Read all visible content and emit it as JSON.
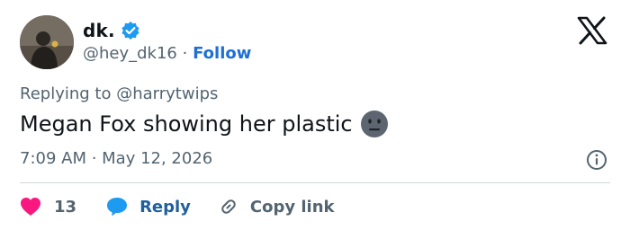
{
  "user": {
    "display_name": "dk.",
    "handle": "@hey_dk16",
    "separator": "·",
    "follow_label": "Follow",
    "verified": true,
    "avatar": "avatar-photo"
  },
  "brand_icon": "x-logo-icon",
  "reply": {
    "prefix": "Replying to",
    "mention": "@harrytwips"
  },
  "tweet": {
    "text": "Megan Fox showing her plastic",
    "emoji": "neutral-face-emoji",
    "timestamp": "7:09 AM · May 12, 2026"
  },
  "actions": {
    "like_count": "13",
    "reply_label": "Reply",
    "copy_label": "Copy link"
  },
  "colors": {
    "accent": "#1d6fd6",
    "like": "#f91880",
    "reply_bubble": "#1d9bf0",
    "muted": "#536471",
    "text": "#0f1419",
    "divider": "#cfd9de"
  }
}
